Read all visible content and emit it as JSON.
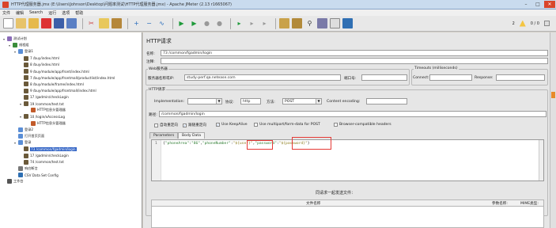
{
  "window": {
    "title": "HTTP代理服务器.jmx (E:\\Users\\Johnson\\Desktop\\问题率测试\\HTTP代理服务器.jmx) - Apache JMeter (2.13 r1665067)",
    "btn_min": "–",
    "btn_max": "□",
    "btn_close": "✕"
  },
  "menu": [
    "文件",
    "编辑",
    "Search",
    "运行",
    "选项",
    "帮助"
  ],
  "toolbar": {
    "warning_count": "2",
    "thread_counter": "0 / 0"
  },
  "tree": {
    "nodes": [
      {
        "label": "测试计划",
        "icon": "test-plan-icon"
      },
      {
        "label": "线程组",
        "icon": "thread-group-icon"
      },
      {
        "label": "登录1",
        "icon": "controller-icon"
      },
      {
        "label": "7 /buy/index.html",
        "icon": "sampler-icon"
      },
      {
        "label": "8 /buy/index.html",
        "icon": "sampler-icon"
      },
      {
        "label": "9 /buy/module/app/front/index.html",
        "icon": "sampler-icon"
      },
      {
        "label": "7 /buy/module/app/frontmall/productlist/index.html",
        "icon": "sampler-icon"
      },
      {
        "label": "8 /buy/module/frame/index.html",
        "icon": "sampler-icon"
      },
      {
        "label": "9 /buy/module/app/frontmall/index.html",
        "icon": "sampler-icon"
      },
      {
        "label": "17 /gadmin/checkLogin",
        "icon": "sampler-icon"
      },
      {
        "label": "19 /common/test.txt",
        "icon": "sampler-icon"
      },
      {
        "label": "HTTP信息头管理器",
        "icon": "config-icon"
      },
      {
        "label": "10 /login/xAccessLog",
        "icon": "sampler-icon"
      },
      {
        "label": "HTTP信息头管理器",
        "icon": "config-icon"
      },
      {
        "label": "登录2",
        "icon": "controller-icon"
      },
      {
        "label": "打开首页页面",
        "icon": "controller-icon"
      },
      {
        "label": "登录",
        "icon": "controller-icon"
      },
      {
        "label": "73 /common/fgadmin/login",
        "icon": "sampler-icon"
      },
      {
        "label": "17 /gadmin/checkLogin",
        "icon": "sampler-icon"
      },
      {
        "label": "74 /common/test.txt",
        "icon": "sampler-icon"
      },
      {
        "label": "响应断言",
        "icon": "assertion-icon"
      },
      {
        "label": "CSV Data Set Config",
        "icon": "csv-icon"
      },
      {
        "label": "工作台",
        "icon": "workbench-icon"
      }
    ]
  },
  "panel": {
    "heading": "HTTP请求",
    "name_label": "名称:",
    "name_value": "73 /common/fgadmin/login",
    "comment_label": "注释:",
    "web_server_group": "Web服务器",
    "server_label": "服务器名称或IP:",
    "server_value": "study-perf.qa.netease.com",
    "port_label": "端口号:",
    "timeouts_group": "Timeouts (milliseconds)",
    "connect_label": "Connect:",
    "response_label": "Response:",
    "http_request_group": "HTTP请求",
    "impl_label": "Implementation:",
    "protocol_label": "协议:",
    "protocol_value": "http",
    "method_label": "方法:",
    "method_value": "POST",
    "encoding_label": "Content encoding:",
    "path_label": "路径:",
    "path_value": "/common/fgadmin/login",
    "cb_redirect_auto": "自动重定向",
    "cb_follow_redirects": "跟随重定向",
    "cb_keepalive": "Use KeepAlive",
    "cb_multipart": "Use multipart/form-data for POST",
    "cb_browser_headers": "Browser-compatible headers",
    "tab_parameters": "Parameters",
    "tab_body": "Body Data",
    "body_line": "1",
    "body_code": [
      {
        "t": "{",
        "c": ""
      },
      {
        "t": "\"phoneArea\"",
        "c": "s"
      },
      {
        "t": ":",
        "c": ""
      },
      {
        "t": "\"86\"",
        "c": "s"
      },
      {
        "t": ",",
        "c": ""
      },
      {
        "t": "\"phoneNumber\"",
        "c": "s"
      },
      {
        "t": ":",
        "c": ""
      },
      {
        "t": "\"${user}\"",
        "c": "k"
      },
      {
        "t": ",",
        "c": ""
      },
      {
        "t": "\"password\"",
        "c": "s"
      },
      {
        "t": ":",
        "c": ""
      },
      {
        "t": "\"${password}\"",
        "c": "k"
      },
      {
        "t": "}",
        "c": ""
      }
    ],
    "files_heading": "同请求一起发送文件：",
    "col_file": "文件名称",
    "col_param": "参数名称:",
    "col_mime": "MIME类型:"
  }
}
